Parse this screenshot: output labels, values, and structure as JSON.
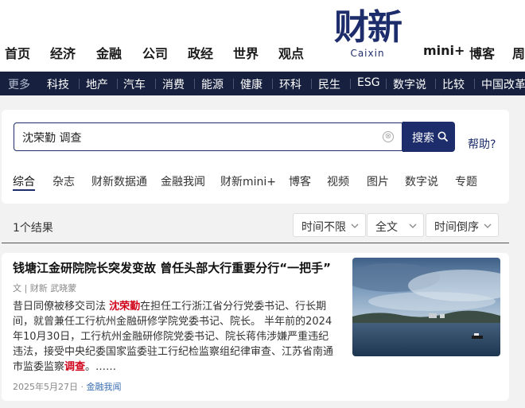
{
  "top_nav": {
    "items": [
      "首页",
      "经济",
      "金融",
      "公司",
      "政经",
      "世界",
      "观点"
    ],
    "right_items": [
      "mini+",
      "博客",
      "周"
    ],
    "logo_cn": "财新",
    "logo_en": "Caixin"
  },
  "category_bar": {
    "items": [
      "更多",
      "科技",
      "地产",
      "汽车",
      "消费",
      "能源",
      "健康",
      "环科",
      "民生",
      "ESG",
      "数字说",
      "比较",
      "中国改革"
    ]
  },
  "search": {
    "value": "沈荣勤 调查",
    "button_label": "搜索",
    "help_label": "帮助?",
    "clear_icon": "⊗"
  },
  "tabs": [
    "综合",
    "杂志",
    "财新数据通",
    "金融我闻",
    "财新mini+",
    "博客",
    "视频",
    "图片",
    "数字说",
    "专题"
  ],
  "results_header": {
    "count_text": "1个结果",
    "filters": [
      "时间不限",
      "全文",
      "时间倒序"
    ]
  },
  "result": {
    "title": "钱塘江金研院院长突发变故 曾任头部大行重要分行“一把手”",
    "meta": "文 | 财新 武晓蒙",
    "body_1": "昔日同僚被移交司法 ",
    "body_hl1": "沈荣勤",
    "body_2": "在担任工行浙江省分行党委书记、行长期间，就曾兼任工行杭州金融研修学院党委书记、院长。 半年前的2024年10月30日，工行杭州金融研修院党委书记、院长蒋伟涉嫌严重违纪违法，接受中央纪委国家监委驻工行纪检监察组纪律审查、江苏省南通市监委监察",
    "body_hl2": "调查",
    "body_3": "。……",
    "date": "2025年5月27日",
    "dot": " · ",
    "source": "金融我闻"
  },
  "colors": {
    "brand": "#1d2d6b",
    "category_bar": "#17213f",
    "highlight": "#d0021b",
    "source_link": "#3a6fb3"
  }
}
